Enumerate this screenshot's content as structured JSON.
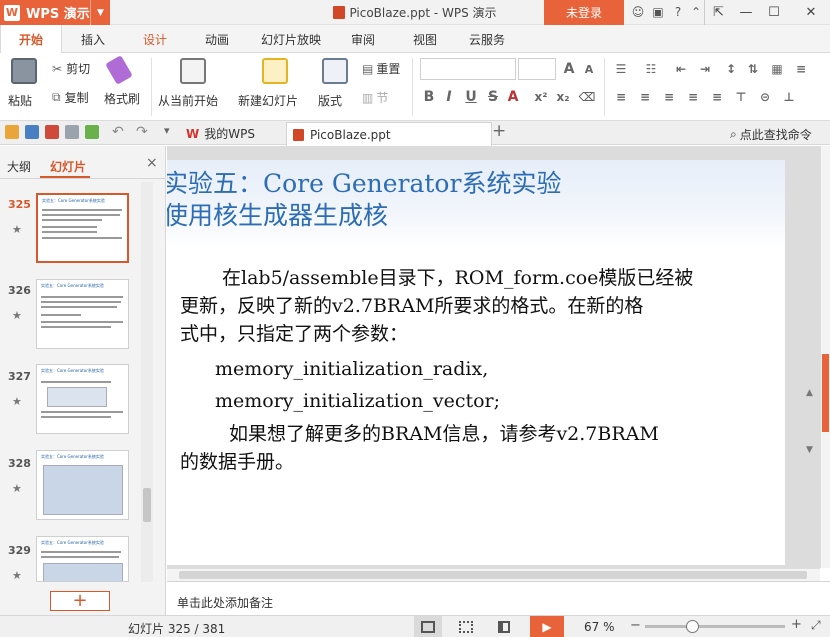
{
  "app": {
    "name": "WPS 演示",
    "logo_letter": "W"
  },
  "window": {
    "title": "PicoBlaze.ppt - WPS 演示",
    "login_label": "未登录"
  },
  "menu_tabs": [
    "开始",
    "插入",
    "设计",
    "动画",
    "幻灯片放映",
    "审阅",
    "视图",
    "云服务"
  ],
  "ribbon": {
    "paste": "粘贴",
    "cut": "剪切",
    "copy": "复制",
    "format_painter": "格式刷",
    "from_current": "从当前开始",
    "new_slide": "新建幻灯片",
    "layout": "版式",
    "reset": "重置",
    "section": "节"
  },
  "doc_tabs": [
    {
      "label": "我的WPS"
    },
    {
      "label": "PicoBlaze.ppt"
    }
  ],
  "search": {
    "label": "点此查找命令"
  },
  "left_pane": {
    "tab_outline": "大纲",
    "tab_slides": "幻灯片",
    "close": "×",
    "thumbnails": [
      {
        "number": "325",
        "title": "实验五：Core Generator系统实验",
        "current": true
      },
      {
        "number": "326",
        "title": "实验五：Core Generator系统实验",
        "current": false
      },
      {
        "number": "327",
        "title": "实验五：Core Generator系统实验",
        "current": false
      },
      {
        "number": "328",
        "title": "实验五：Core Generator系统实验",
        "current": false
      },
      {
        "number": "329",
        "title": "实验五：Core Generator系统实验",
        "current": false
      }
    ],
    "add_button": "+"
  },
  "slide": {
    "title_line1": "实验五：Core Generator系统实验",
    "title_line2": "使用核生成器生成核",
    "para1_line1": "在lab5/assemble目录下，ROM_form.coe模版已经被",
    "para1_line2": "更新，反映了新的v2.7BRAM所要求的格式。在新的格",
    "para1_line3": "式中，只指定了两个参数：",
    "param1": "memory_initialization_radix,",
    "param2": "memory_initialization_vector;",
    "para2_line1": "如果想了解更多的BRAM信息，请参考v2.7BRAM",
    "para2_line2": "的数据手册。"
  },
  "notes": {
    "placeholder": "单击此处添加备注"
  },
  "status": {
    "slide_counter": "幻灯片 325 / 381",
    "zoom": "67 %",
    "zoom_fraction": 0.67
  },
  "colors": {
    "accent": "#e8633a",
    "title_blue": "#2d6db5",
    "active_tab": "#d7592b"
  }
}
